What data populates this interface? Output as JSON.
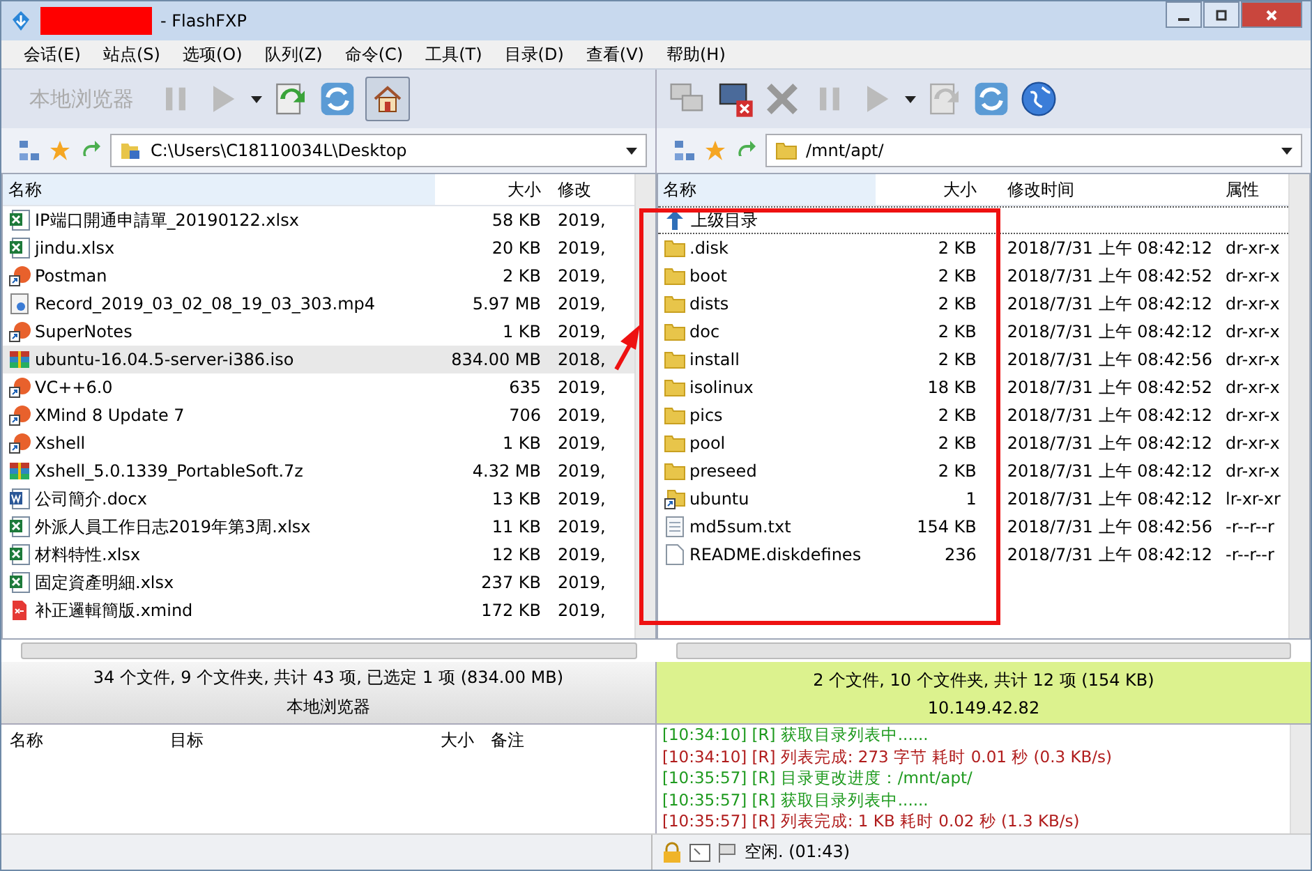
{
  "window": {
    "title": "- FlashFXP"
  },
  "menu": [
    "会话(E)",
    "站点(S)",
    "选项(O)",
    "队列(Z)",
    "命令(C)",
    "工具(T)",
    "目录(D)",
    "查看(V)",
    "帮助(H)"
  ],
  "left": {
    "toolbar_label": "本地浏览器",
    "path": "C:\\Users\\C18110034L\\Desktop",
    "columns": [
      "名称",
      "大小",
      "修改"
    ],
    "rows": [
      {
        "name": "IP端口開通申請單_20190122.xlsx",
        "size": "58 KB",
        "date": "2019,",
        "kind": "spreadsheet",
        "selected": false
      },
      {
        "name": "jindu.xlsx",
        "size": "20 KB",
        "date": "2019,",
        "kind": "spreadsheet",
        "selected": false
      },
      {
        "name": "Postman",
        "size": "2 KB",
        "date": "2019,",
        "kind": "shortcut",
        "selected": false
      },
      {
        "name": "Record_2019_03_02_08_19_03_303.mp4",
        "size": "5.97 MB",
        "date": "2019,",
        "kind": "video",
        "selected": false
      },
      {
        "name": "SuperNotes",
        "size": "1 KB",
        "date": "2019,",
        "kind": "shortcut",
        "selected": false
      },
      {
        "name": "ubuntu-16.04.5-server-i386.iso",
        "size": "834.00 MB",
        "date": "2018,",
        "kind": "archive",
        "selected": true
      },
      {
        "name": "VC++6.0",
        "size": "635",
        "date": "2019,",
        "kind": "shortcut",
        "selected": false
      },
      {
        "name": "XMind 8 Update 7",
        "size": "706",
        "date": "2019,",
        "kind": "shortcut",
        "selected": false
      },
      {
        "name": "Xshell",
        "size": "1 KB",
        "date": "2019,",
        "kind": "shortcut",
        "selected": false
      },
      {
        "name": "Xshell_5.0.1339_PortableSoft.7z",
        "size": "4.32 MB",
        "date": "2019,",
        "kind": "archive",
        "selected": false
      },
      {
        "name": "公司簡介.docx",
        "size": "13 KB",
        "date": "2019,",
        "kind": "document",
        "selected": false
      },
      {
        "name": "外派人員工作日志2019年第3周.xlsx",
        "size": "11 KB",
        "date": "2019,",
        "kind": "spreadsheet",
        "selected": false
      },
      {
        "name": "材料特性.xlsx",
        "size": "12 KB",
        "date": "2019,",
        "kind": "spreadsheet",
        "selected": false
      },
      {
        "name": "固定資產明細.xlsx",
        "size": "237 KB",
        "date": "2019,",
        "kind": "spreadsheet",
        "selected": false
      },
      {
        "name": "补正邏輯簡版.xmind",
        "size": "172 KB",
        "date": "2019,",
        "kind": "mindmap",
        "selected": false
      }
    ],
    "status": "34 个文件, 9 个文件夹, 共计 43 项, 已选定 1 项 (834.00 MB)",
    "status_2": "本地浏览器"
  },
  "right": {
    "path": "/mnt/apt/",
    "columns": [
      "名称",
      "大小",
      "修改时间",
      "属性"
    ],
    "parent_row": "上级目录",
    "rows": [
      {
        "name": ".disk",
        "size": "2 KB",
        "date": "2018/7/31 上午 08:42:12",
        "attr": "dr-xr-x",
        "kind": "folder"
      },
      {
        "name": "boot",
        "size": "2 KB",
        "date": "2018/7/31 上午 08:42:52",
        "attr": "dr-xr-x",
        "kind": "folder"
      },
      {
        "name": "dists",
        "size": "2 KB",
        "date": "2018/7/31 上午 08:42:12",
        "attr": "dr-xr-x",
        "kind": "folder"
      },
      {
        "name": "doc",
        "size": "2 KB",
        "date": "2018/7/31 上午 08:42:12",
        "attr": "dr-xr-x",
        "kind": "folder"
      },
      {
        "name": "install",
        "size": "2 KB",
        "date": "2018/7/31 上午 08:42:56",
        "attr": "dr-xr-x",
        "kind": "folder"
      },
      {
        "name": "isolinux",
        "size": "18 KB",
        "date": "2018/7/31 上午 08:42:52",
        "attr": "dr-xr-x",
        "kind": "folder"
      },
      {
        "name": "pics",
        "size": "2 KB",
        "date": "2018/7/31 上午 08:42:12",
        "attr": "dr-xr-x",
        "kind": "folder"
      },
      {
        "name": "pool",
        "size": "2 KB",
        "date": "2018/7/31 上午 08:42:12",
        "attr": "dr-xr-x",
        "kind": "folder"
      },
      {
        "name": "preseed",
        "size": "2 KB",
        "date": "2018/7/31 上午 08:42:12",
        "attr": "dr-xr-x",
        "kind": "folder"
      },
      {
        "name": "ubuntu",
        "size": "1",
        "date": "2018/7/31 上午 08:42:12",
        "attr": "lr-xr-xr",
        "kind": "link"
      },
      {
        "name": "md5sum.txt",
        "size": "154 KB",
        "date": "2018/7/31 上午 08:42:56",
        "attr": "-r--r--r",
        "kind": "text"
      },
      {
        "name": "README.diskdefines",
        "size": "236",
        "date": "2018/7/31 上午 08:42:12",
        "attr": "-r--r--r",
        "kind": "file"
      }
    ],
    "status": "2 个文件, 10 个文件夹, 共计 12 项 (154 KB)",
    "host": "10.149.42.82"
  },
  "queue": {
    "columns": [
      "名称",
      "目标",
      "大小",
      "备注"
    ]
  },
  "log": [
    {
      "text": "[10:34:10] [R] 获取目录列表中......",
      "color": "#1e9a1e"
    },
    {
      "text": "[10:34:10] [R] 列表完成: 273 字节 耗时 0.01 秒 (0.3 KB/s)",
      "color": "#b01c1c"
    },
    {
      "text": "[10:35:57] [R] 目录更改进度：/mnt/apt/",
      "color": "#1e9a1e"
    },
    {
      "text": "[10:35:57] [R] 获取目录列表中......",
      "color": "#1e9a1e"
    },
    {
      "text": "[10:35:57] [R] 列表完成: 1 KB 耗时 0.02 秒 (1.3 KB/s)",
      "color": "#b01c1c"
    }
  ],
  "status_bar": "空闲. (01:43)"
}
